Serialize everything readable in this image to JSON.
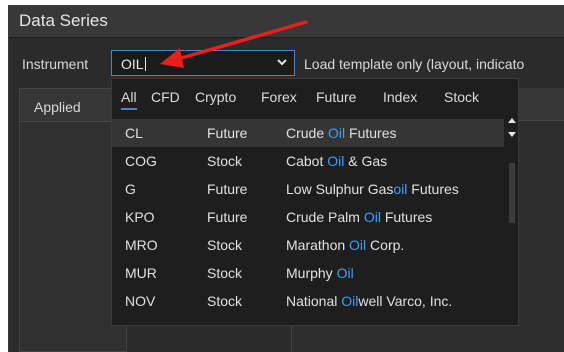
{
  "window": {
    "title": "Data Series"
  },
  "instrument": {
    "label": "Instrument",
    "value": "OIL",
    "load_template_text": "Load template only (layout, indicato"
  },
  "left_panel": {
    "header": "Applied"
  },
  "dropdown": {
    "tabs": [
      {
        "label": "All",
        "active": true
      },
      {
        "label": "CFD"
      },
      {
        "label": "Crypto"
      },
      {
        "label": "Forex"
      },
      {
        "label": "Future"
      },
      {
        "label": "Index"
      },
      {
        "label": "Stock"
      }
    ],
    "rows": [
      {
        "symbol": "CL",
        "type": "Future",
        "name_pre": "Crude ",
        "name_hl": "Oil",
        "name_post": " Futures",
        "selected": true
      },
      {
        "symbol": "COG",
        "type": "Stock",
        "name_pre": "Cabot ",
        "name_hl": "Oil",
        "name_post": " & Gas"
      },
      {
        "symbol": "G",
        "type": "Future",
        "name_pre": "Low Sulphur Gas",
        "name_hl": "oil",
        "name_post": " Futures"
      },
      {
        "symbol": "KPO",
        "type": "Future",
        "name_pre": "Crude Palm ",
        "name_hl": "Oil",
        "name_post": " Futures"
      },
      {
        "symbol": "MRO",
        "type": "Stock",
        "name_pre": "Marathon ",
        "name_hl": "Oil",
        "name_post": " Corp."
      },
      {
        "symbol": "MUR",
        "type": "Stock",
        "name_pre": "Murphy ",
        "name_hl": "Oil",
        "name_post": ""
      },
      {
        "symbol": "NOV",
        "type": "Stock",
        "name_pre": "National ",
        "name_hl": "Oil",
        "name_post": "well Varco, Inc."
      }
    ]
  },
  "colors": {
    "accent": "#4a86c8",
    "highlight": "#3aa0ff",
    "arrow": "#e8201c"
  }
}
